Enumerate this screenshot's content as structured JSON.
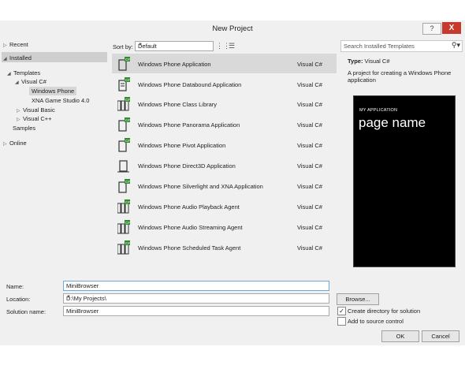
{
  "window": {
    "title": "New Project",
    "help_label": "?",
    "close_label": "X"
  },
  "nav": {
    "recent": "Recent",
    "installed": "Installed",
    "templates": "Templates",
    "visual_csharp": "Visual C#",
    "windows_phone": "Windows Phone",
    "xna": "XNA Game Studio 4.0",
    "visual_basic": "Visual Basic",
    "visual_cpp": "Visual C++",
    "samples": "Samples",
    "online": "Online"
  },
  "sort": {
    "label": "Sort by:",
    "value": "Default"
  },
  "search": {
    "placeholder": "Search Installed Templates"
  },
  "templates": [
    {
      "name": "Windows Phone Application",
      "lang": "Visual C#"
    },
    {
      "name": "Windows Phone Databound Application",
      "lang": "Visual C#"
    },
    {
      "name": "Windows Phone Class Library",
      "lang": "Visual C#"
    },
    {
      "name": "Windows Phone Panorama Application",
      "lang": "Visual C#"
    },
    {
      "name": "Windows Phone Pivot Application",
      "lang": "Visual C#"
    },
    {
      "name": "Windows Phone Direct3D Application",
      "lang": "Visual C#"
    },
    {
      "name": "Windows Phone Silverlight and XNA Application",
      "lang": "Visual C#"
    },
    {
      "name": "Windows Phone Audio Playback Agent",
      "lang": "Visual C#"
    },
    {
      "name": "Windows Phone Audio Streaming Agent",
      "lang": "Visual C#"
    },
    {
      "name": "Windows Phone Scheduled Task Agent",
      "lang": "Visual C#"
    }
  ],
  "details": {
    "type_label": "Type:",
    "type_value": "Visual C#",
    "description": "A project for creating a Windows Phone application",
    "preview_app_title": "MY APPLICATION",
    "preview_page_name": "page name"
  },
  "form": {
    "name_label": "Name:",
    "name_value": "MiniBrowser",
    "location_label": "Location:",
    "location_value": "D:\\My Projects\\",
    "solution_label": "Solution name:",
    "solution_value": "MiniBrowser",
    "browse_label": "Browse...",
    "create_dir_label": "Create directory for solution",
    "create_dir_checked": true,
    "source_control_label": "Add to source control",
    "source_control_checked": false,
    "ok_label": "OK",
    "cancel_label": "Cancel"
  },
  "colors": {
    "accent_green": "#2e8b2e",
    "close_red": "#c7392c",
    "selected_row": "#d9d9d9"
  }
}
